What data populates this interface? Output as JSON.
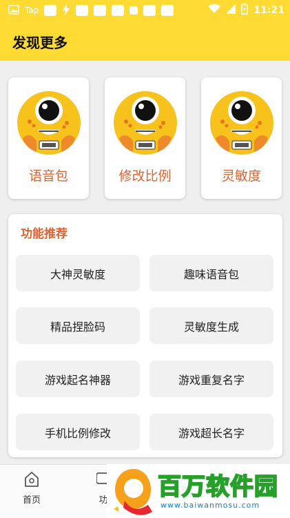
{
  "status_bar": {
    "carrier": "Tap",
    "time": "11:21"
  },
  "header": {
    "title": "发现更多"
  },
  "cards": [
    {
      "label": "语音包",
      "icon": "mascot-icon"
    },
    {
      "label": "修改比例",
      "icon": "mascot-icon"
    },
    {
      "label": "灵敏度",
      "icon": "mascot-icon"
    }
  ],
  "recommend": {
    "title": "功能推荐",
    "items": [
      {
        "label": "大神灵敏度"
      },
      {
        "label": "趣味语音包"
      },
      {
        "label": "精品捏脸码"
      },
      {
        "label": "灵敏度生成"
      },
      {
        "label": "游戏起名神器"
      },
      {
        "label": "游戏重复名字"
      },
      {
        "label": "手机比例修改"
      },
      {
        "label": "游戏超长名字"
      }
    ]
  },
  "bottom_nav": {
    "home_label": "首页",
    "func_label": "功"
  },
  "watermark": {
    "title": "百万软件园",
    "url": "www.baiwanmosu.com"
  },
  "colors": {
    "accent_yellow": "#fedb32",
    "accent_orange": "#e2622e",
    "watermark_green": "#27a02a"
  }
}
